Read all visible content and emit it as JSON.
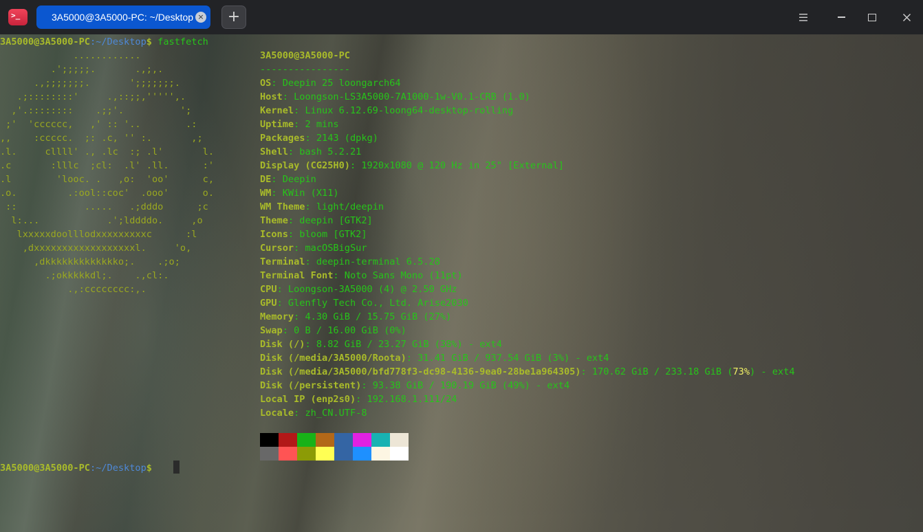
{
  "titlebar": {
    "app_icon_glyph": ">_",
    "tab_title": "3A5000@3A5000-PC: ~/Desktop",
    "tab_close_glyph": "×",
    "new_tab_glyph": "+",
    "icons": [
      "terminal-app-icon",
      "close-icon",
      "plus-icon",
      "menu-icon",
      "minimize-icon",
      "maximize-icon",
      "close-icon"
    ]
  },
  "prompt": {
    "user": "3A5000@3A5000-PC",
    "path": ":~/Desktop",
    "dollar": "$",
    "command": " fastfetch"
  },
  "logo_lines": [
    "             ............",
    "         .';;;;;.       .,;,.",
    "      .,;;;;;;;.       ';;;;;;;.",
    "   .;::::::::'     .,::;;,''''',.",
    "  ,'.::::::::    .;;'.          ';",
    " ;'  'cccccc,   ,' :: '..        .:",
    ",,    :ccccc.  ;: .c, '' :.       ,;",
    ".l.     cllll' ., .lc  :; .l'       l.",
    ".c       :lllc  ;cl:  .l' .ll.      :'",
    ".l        'looc. .   ,o:  'oo'      c,",
    ".o.         .:ool::coc'  .ooo'      o.",
    " ::            .....   .;dddo      ;c",
    "  l:...            .';lddddo.     ,o",
    "   lxxxxxdoolllodxxxxxxxxxc      :l",
    "    ,dxxxxxxxxxxxxxxxxxxl.     'o,",
    "      ,dkkkkkkkkkkkkko;.    .;o;",
    "        .;okkkkkdl;.    .,cl:.",
    "            .,:cccccccc:,."
  ],
  "info": {
    "header": "3A5000@3A5000-PC",
    "separator": "----------------",
    "rows": [
      {
        "key": "OS",
        "value": ": Deepin 25 loongarch64"
      },
      {
        "key": "Host",
        "value": ": Loongson-LS3A5000-7A1000-1w-V0.1-CRB (1.0)"
      },
      {
        "key": "Kernel",
        "value": ": Linux 6.12.69-loong64-desktop-rolling"
      },
      {
        "key": "Uptime",
        "value": ": 2 mins"
      },
      {
        "key": "Packages",
        "value": ": 2143 (dpkg)"
      },
      {
        "key": "Shell",
        "value": ": bash 5.2.21"
      },
      {
        "key": "Display (CG25H0)",
        "value": ": 1920x1080 @ 120 Hz in 25\" [External]"
      },
      {
        "key": "DE",
        "value": ": Deepin"
      },
      {
        "key": "WM",
        "value": ": KWin (X11)"
      },
      {
        "key": "WM Theme",
        "value": ": light/deepin"
      },
      {
        "key": "Theme",
        "value": ": deepin [GTK2]"
      },
      {
        "key": "Icons",
        "value": ": bloom [GTK2]"
      },
      {
        "key": "Cursor",
        "value": ": macOSBigSur"
      },
      {
        "key": "Terminal",
        "value": ": deepin-terminal 6.5.28"
      },
      {
        "key": "Terminal Font",
        "value": ": Noto Sans Mono (11pt)"
      },
      {
        "key": "CPU",
        "value": ": Loongson-3A5000 (4) @ 2.50 GHz"
      },
      {
        "key": "GPU",
        "value": ": Glenfly Tech Co., Ltd. Arise2030"
      },
      {
        "key": "Memory",
        "value": ": 4.30 GiB / 15.75 GiB (27%)"
      },
      {
        "key": "Swap",
        "value": ": 0 B / 16.00 GiB (0%)"
      },
      {
        "key": "Disk (/)",
        "value": ": 8.82 GiB / 23.27 GiB (38%) - ext4"
      },
      {
        "key": "Disk (/media/3A5000/Roota)",
        "value": ": 31.41 GiB / 937.54 GiB (3%) - ext4"
      },
      {
        "key": "Disk (/media/3A5000/bfd778f3-dc98-4136-9ea0-28be1a964305)",
        "value": ": 170.62 GiB / 233.18 GiB (",
        "highlight": "73%",
        "suffix": ") - ext4"
      },
      {
        "key": "Disk (/persistent)",
        "value": ": 93.38 GiB / 190.19 GiB (49%) - ext4"
      },
      {
        "key": "Local IP (enp2s0)",
        "value": ": 192.168.1.111/24"
      },
      {
        "key": "Locale",
        "value": ": zh_CN.UTF-8"
      }
    ]
  },
  "palette": {
    "normal": [
      "#000000",
      "#b21818",
      "#18b218",
      "#b26818",
      "#3465a4",
      "#e221e2",
      "#18b2b2",
      "#ede6d6"
    ],
    "bright": [
      "#686868",
      "#ff5454",
      "#8c9b06",
      "#ffff54",
      "#3465a4",
      "#1e90ff",
      "#fdf6e3",
      "#ffffff"
    ]
  }
}
